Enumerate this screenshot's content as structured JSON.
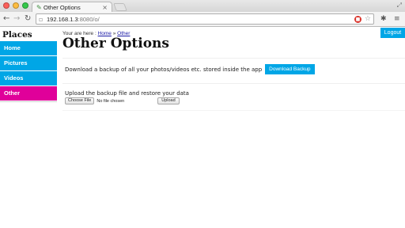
{
  "browser": {
    "tab_title": "Other Options",
    "tab_close": "×",
    "url_host": "192.168.1.3",
    "url_path": ":8080/o/"
  },
  "sidebar": {
    "title": "Places",
    "items": [
      {
        "label": "Home"
      },
      {
        "label": "Pictures"
      },
      {
        "label": "Videos"
      },
      {
        "label": "Other",
        "active": true
      }
    ]
  },
  "header": {
    "logout_label": "Logout"
  },
  "breadcrumb": {
    "prefix": "Your are here :",
    "home_label": "Home",
    "separator": "»",
    "current_label": "Other"
  },
  "main": {
    "title": "Other Options",
    "backup_text": "Download a backup of all your photos/videos etc. stored inside the app",
    "download_button": "Download Backup",
    "restore_text": "Upload the backup file and restore your data",
    "choose_file_button": "Choose File",
    "no_file_text": "No file chosen",
    "upload_button": "Upload"
  },
  "colors": {
    "accent": "#00a6e6",
    "active_nav": "#e0009a"
  }
}
